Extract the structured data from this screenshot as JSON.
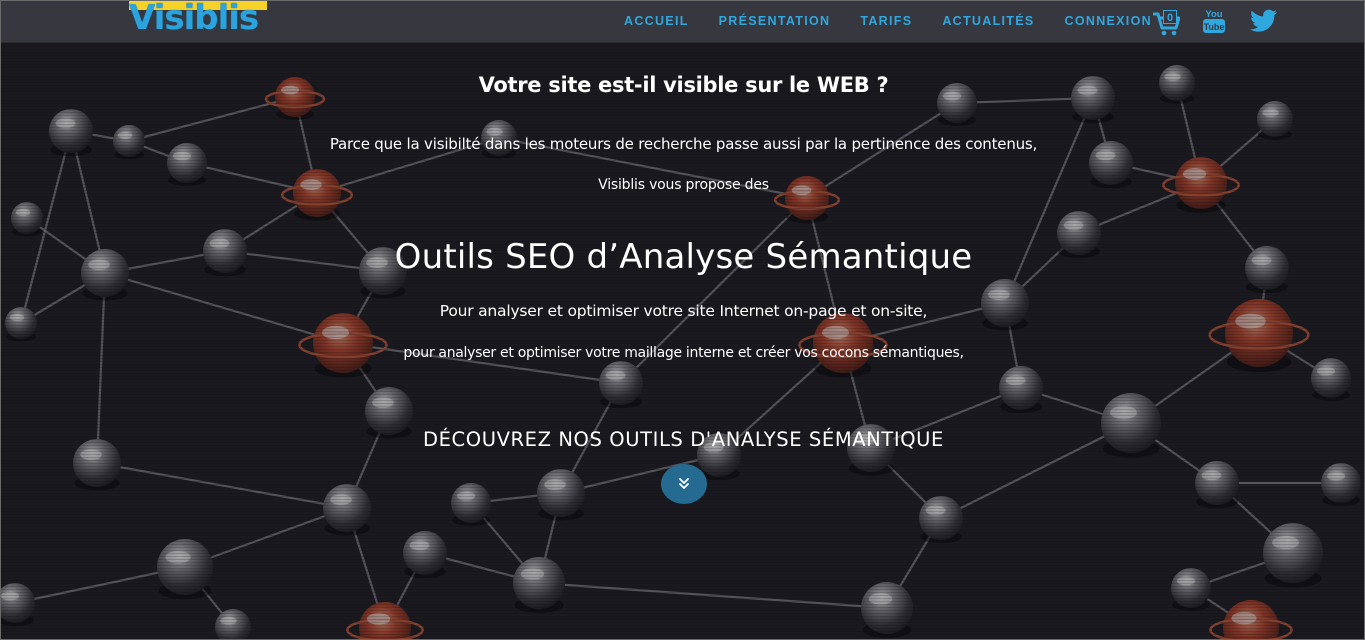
{
  "brand": {
    "logo_text": "Visiblis",
    "logo_bar_color": "#f6d12a",
    "logo_color": "#2aa3de"
  },
  "nav": {
    "items": [
      {
        "label": "ACCUEIL"
      },
      {
        "label": "PRÉSENTATION"
      },
      {
        "label": "TARIFS"
      },
      {
        "label": "ACTUALITÉS"
      },
      {
        "label": "CONNEXION"
      }
    ],
    "cart_count": "0",
    "youtube_text_top": "You",
    "youtube_text_bottom": "Tube",
    "icons": [
      "cart-icon",
      "youtube-icon",
      "twitter-icon"
    ],
    "link_color": "#2ea8df",
    "bar_color": "#37373f"
  },
  "hero": {
    "title": "Votre site est-il visible sur le WEB ?",
    "lead_line1": "Parce que la visibilté dans les moteurs de recherche passe aussi par la pertinence des contenus,",
    "lead_line2": "Visiblis vous propose des",
    "headline": "Outils SEO d’Analyse Sémantique",
    "sub_line1": "Pour analyser et optimiser votre site Internet on-page et on-site,",
    "sub_line2": "pour analyser et optimiser votre maillage interne et créer vos cocons sémantiques,",
    "cta": "DÉCOUVREZ NOS OUTILS D'ANALYSE SÉMANTIQUE",
    "scroll_icon": "double-chevron-down-icon",
    "button_color": "#246a91"
  }
}
